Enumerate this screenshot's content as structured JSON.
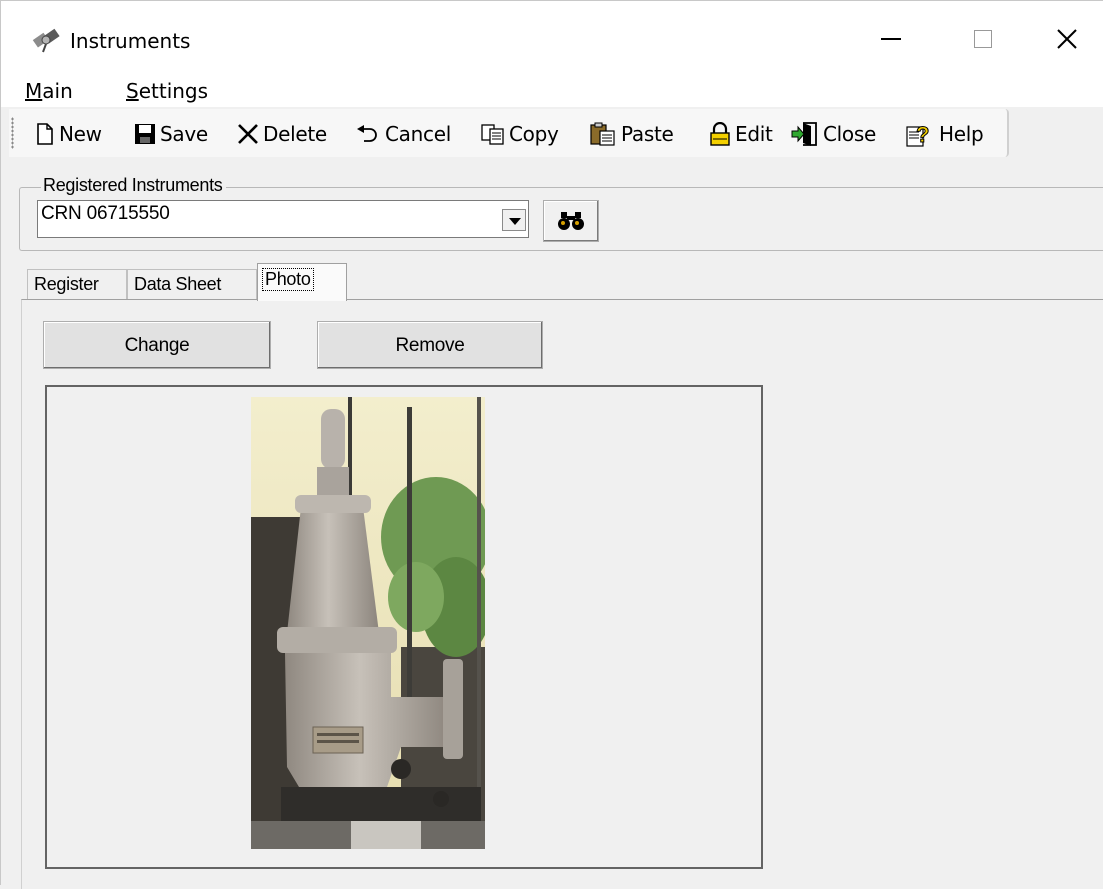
{
  "window": {
    "title": "Instruments",
    "app_icon": "satellite-icon",
    "controls": [
      "minimize-icon",
      "maximize-icon",
      "close-icon"
    ]
  },
  "menu": {
    "items": [
      {
        "mnemonic": "M",
        "rest": "ain"
      },
      {
        "mnemonic": "S",
        "rest": "ettings"
      }
    ]
  },
  "toolbar": {
    "buttons": [
      {
        "label": "New",
        "icon": "new-document-icon"
      },
      {
        "label": "Save",
        "icon": "floppy-disk-icon"
      },
      {
        "label": "Delete",
        "icon": "x-mark-icon"
      },
      {
        "label": "Cancel",
        "icon": "undo-arrow-icon"
      },
      {
        "label": "Copy",
        "icon": "copy-icon"
      },
      {
        "label": "Paste",
        "icon": "clipboard-icon"
      },
      {
        "label": "Edit",
        "icon": "padlock-icon"
      },
      {
        "label": "Close",
        "icon": "exit-door-icon"
      },
      {
        "label": "Help",
        "icon": "help-question-icon"
      }
    ]
  },
  "registered": {
    "legend": "Registered Instruments",
    "selected": "CRN 06715550",
    "find_icon": "binoculars-icon"
  },
  "tabs": [
    {
      "label": "Register",
      "selected": false
    },
    {
      "label": "Data Sheet",
      "selected": false
    },
    {
      "label": "Photo",
      "selected": true
    }
  ],
  "photo_tab": {
    "change_label": "Change",
    "remove_label": "Remove",
    "photo_subject": "pressure-relief-valve-photo"
  },
  "colors": {
    "window_bg": "#f0f0f0",
    "titlebar_bg": "#ffffff",
    "frame_border": "#646464",
    "valve_body": "#b0aaa3",
    "sky": "#efe9c6",
    "foliage": "#6f9a53"
  }
}
